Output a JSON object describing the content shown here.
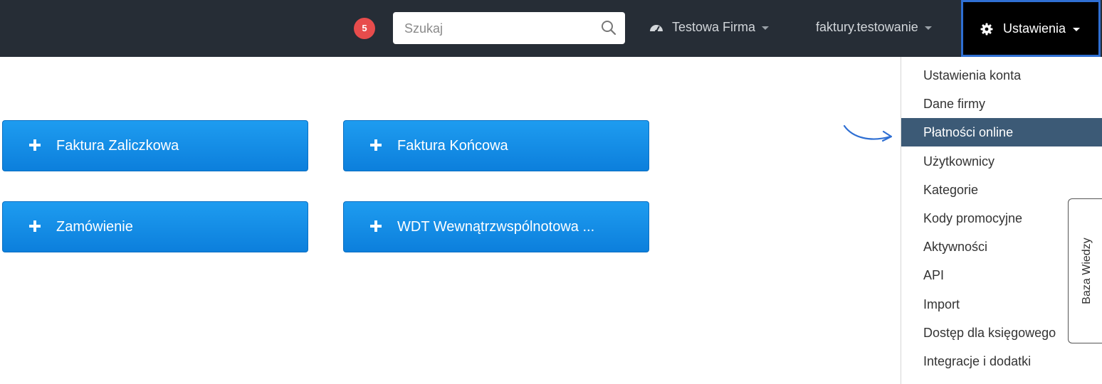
{
  "navbar": {
    "notification_count": "5",
    "search": {
      "placeholder": "Szukaj",
      "value": ""
    },
    "company_label": "Testowa Firma",
    "account_label": "faktury.testowanie",
    "settings_label": "Ustawienia"
  },
  "actions": [
    {
      "label": "Faktura Zaliczkowa"
    },
    {
      "label": "Faktura Końcowa"
    },
    {
      "label": "Zamówienie"
    },
    {
      "label": "WDT Wewnątrzwspólnotowa ..."
    }
  ],
  "settings_menu": {
    "items": [
      {
        "label": "Ustawienia konta"
      },
      {
        "label": "Dane firmy"
      },
      {
        "label": "Płatności online"
      },
      {
        "label": "Użytkownicy"
      },
      {
        "label": "Kategorie"
      },
      {
        "label": "Kody promocyjne"
      },
      {
        "label": "Aktywności"
      },
      {
        "label": "API"
      },
      {
        "label": "Import"
      },
      {
        "label": "Dostęp dla księgowego"
      },
      {
        "label": "Integracje i dodatki"
      }
    ],
    "highlighted_item": "Płatności online"
  },
  "knowledge_base_tab": {
    "label": "Baza Wiedzy"
  },
  "colors": {
    "navbar": "#262d36",
    "badge": "#e74c4c",
    "button": "#1487e6",
    "menu_active": "#3c5a76",
    "focus_border": "#2f6fd3",
    "arrow": "#2f6fd3"
  }
}
